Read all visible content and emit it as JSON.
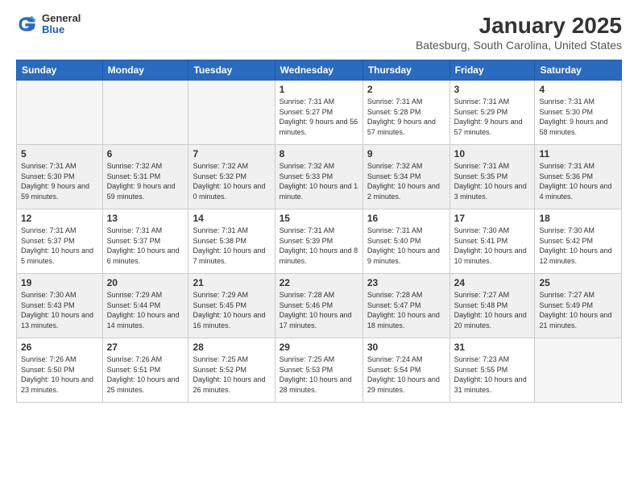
{
  "header": {
    "logo_general": "General",
    "logo_blue": "Blue",
    "title": "January 2025",
    "subtitle": "Batesburg, South Carolina, United States"
  },
  "days_of_week": [
    "Sunday",
    "Monday",
    "Tuesday",
    "Wednesday",
    "Thursday",
    "Friday",
    "Saturday"
  ],
  "weeks": [
    {
      "shaded": false,
      "days": [
        {
          "num": "",
          "info": ""
        },
        {
          "num": "",
          "info": ""
        },
        {
          "num": "",
          "info": ""
        },
        {
          "num": "1",
          "info": "Sunrise: 7:31 AM\nSunset: 5:27 PM\nDaylight: 9 hours\nand 56 minutes."
        },
        {
          "num": "2",
          "info": "Sunrise: 7:31 AM\nSunset: 5:28 PM\nDaylight: 9 hours\nand 57 minutes."
        },
        {
          "num": "3",
          "info": "Sunrise: 7:31 AM\nSunset: 5:29 PM\nDaylight: 9 hours\nand 57 minutes."
        },
        {
          "num": "4",
          "info": "Sunrise: 7:31 AM\nSunset: 5:30 PM\nDaylight: 9 hours\nand 58 minutes."
        }
      ]
    },
    {
      "shaded": true,
      "days": [
        {
          "num": "5",
          "info": "Sunrise: 7:31 AM\nSunset: 5:30 PM\nDaylight: 9 hours\nand 59 minutes."
        },
        {
          "num": "6",
          "info": "Sunrise: 7:32 AM\nSunset: 5:31 PM\nDaylight: 9 hours\nand 59 minutes."
        },
        {
          "num": "7",
          "info": "Sunrise: 7:32 AM\nSunset: 5:32 PM\nDaylight: 10 hours\nand 0 minutes."
        },
        {
          "num": "8",
          "info": "Sunrise: 7:32 AM\nSunset: 5:33 PM\nDaylight: 10 hours\nand 1 minute."
        },
        {
          "num": "9",
          "info": "Sunrise: 7:32 AM\nSunset: 5:34 PM\nDaylight: 10 hours\nand 2 minutes."
        },
        {
          "num": "10",
          "info": "Sunrise: 7:31 AM\nSunset: 5:35 PM\nDaylight: 10 hours\nand 3 minutes."
        },
        {
          "num": "11",
          "info": "Sunrise: 7:31 AM\nSunset: 5:36 PM\nDaylight: 10 hours\nand 4 minutes."
        }
      ]
    },
    {
      "shaded": false,
      "days": [
        {
          "num": "12",
          "info": "Sunrise: 7:31 AM\nSunset: 5:37 PM\nDaylight: 10 hours\nand 5 minutes."
        },
        {
          "num": "13",
          "info": "Sunrise: 7:31 AM\nSunset: 5:37 PM\nDaylight: 10 hours\nand 6 minutes."
        },
        {
          "num": "14",
          "info": "Sunrise: 7:31 AM\nSunset: 5:38 PM\nDaylight: 10 hours\nand 7 minutes."
        },
        {
          "num": "15",
          "info": "Sunrise: 7:31 AM\nSunset: 5:39 PM\nDaylight: 10 hours\nand 8 minutes."
        },
        {
          "num": "16",
          "info": "Sunrise: 7:31 AM\nSunset: 5:40 PM\nDaylight: 10 hours\nand 9 minutes."
        },
        {
          "num": "17",
          "info": "Sunrise: 7:30 AM\nSunset: 5:41 PM\nDaylight: 10 hours\nand 10 minutes."
        },
        {
          "num": "18",
          "info": "Sunrise: 7:30 AM\nSunset: 5:42 PM\nDaylight: 10 hours\nand 12 minutes."
        }
      ]
    },
    {
      "shaded": true,
      "days": [
        {
          "num": "19",
          "info": "Sunrise: 7:30 AM\nSunset: 5:43 PM\nDaylight: 10 hours\nand 13 minutes."
        },
        {
          "num": "20",
          "info": "Sunrise: 7:29 AM\nSunset: 5:44 PM\nDaylight: 10 hours\nand 14 minutes."
        },
        {
          "num": "21",
          "info": "Sunrise: 7:29 AM\nSunset: 5:45 PM\nDaylight: 10 hours\nand 16 minutes."
        },
        {
          "num": "22",
          "info": "Sunrise: 7:28 AM\nSunset: 5:46 PM\nDaylight: 10 hours\nand 17 minutes."
        },
        {
          "num": "23",
          "info": "Sunrise: 7:28 AM\nSunset: 5:47 PM\nDaylight: 10 hours\nand 18 minutes."
        },
        {
          "num": "24",
          "info": "Sunrise: 7:27 AM\nSunset: 5:48 PM\nDaylight: 10 hours\nand 20 minutes."
        },
        {
          "num": "25",
          "info": "Sunrise: 7:27 AM\nSunset: 5:49 PM\nDaylight: 10 hours\nand 21 minutes."
        }
      ]
    },
    {
      "shaded": false,
      "days": [
        {
          "num": "26",
          "info": "Sunrise: 7:26 AM\nSunset: 5:50 PM\nDaylight: 10 hours\nand 23 minutes."
        },
        {
          "num": "27",
          "info": "Sunrise: 7:26 AM\nSunset: 5:51 PM\nDaylight: 10 hours\nand 25 minutes."
        },
        {
          "num": "28",
          "info": "Sunrise: 7:25 AM\nSunset: 5:52 PM\nDaylight: 10 hours\nand 26 minutes."
        },
        {
          "num": "29",
          "info": "Sunrise: 7:25 AM\nSunset: 5:53 PM\nDaylight: 10 hours\nand 28 minutes."
        },
        {
          "num": "30",
          "info": "Sunrise: 7:24 AM\nSunset: 5:54 PM\nDaylight: 10 hours\nand 29 minutes."
        },
        {
          "num": "31",
          "info": "Sunrise: 7:23 AM\nSunset: 5:55 PM\nDaylight: 10 hours\nand 31 minutes."
        },
        {
          "num": "",
          "info": ""
        }
      ]
    }
  ]
}
